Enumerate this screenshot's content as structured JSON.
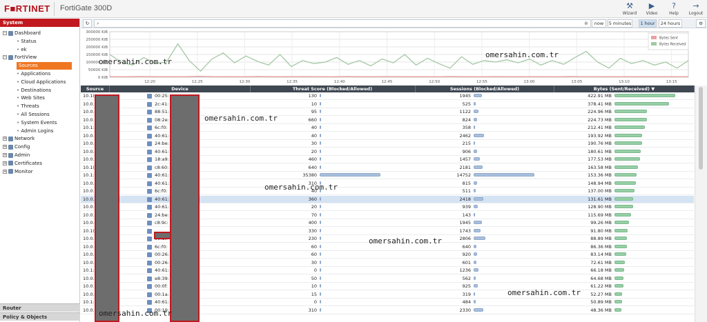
{
  "app": {
    "logo": "F■RTINET",
    "model": "FortiGate 300D"
  },
  "top_actions": [
    {
      "label": "Wizard",
      "icon": "wizard-icon",
      "glyph": "⚒"
    },
    {
      "label": "Video",
      "icon": "video-icon",
      "glyph": "▶"
    },
    {
      "label": "Help",
      "icon": "help-icon",
      "glyph": "?"
    },
    {
      "label": "Logout",
      "icon": "logout-icon",
      "glyph": "→"
    }
  ],
  "sidebar": {
    "section": "System",
    "tree": [
      {
        "label": "Dashboard",
        "level": 0,
        "expand": "−",
        "icon": true
      },
      {
        "label": "Status",
        "level": 1
      },
      {
        "label": "ek",
        "level": 1
      },
      {
        "label": "FortiView",
        "level": 0,
        "expand": "−",
        "icon": true
      },
      {
        "label": "Sources",
        "level": 1,
        "selected": true
      },
      {
        "label": "Applications",
        "level": 1
      },
      {
        "label": "Cloud Applications",
        "level": 1
      },
      {
        "label": "Destinations",
        "level": 1
      },
      {
        "label": "Web Sites",
        "level": 1
      },
      {
        "label": "Threats",
        "level": 1
      },
      {
        "label": "All Sessions",
        "level": 1
      },
      {
        "label": "System Events",
        "level": 1
      },
      {
        "label": "Admin Logins",
        "level": 1
      },
      {
        "label": "Network",
        "level": 0,
        "expand": "+",
        "icon": true
      },
      {
        "label": "Config",
        "level": 0,
        "expand": "+",
        "icon": true
      },
      {
        "label": "Admin",
        "level": 0,
        "expand": "+",
        "icon": true
      },
      {
        "label": "Certificates",
        "level": 0,
        "expand": "+",
        "icon": true
      },
      {
        "label": "Monitor",
        "level": 0,
        "expand": "+",
        "icon": true
      }
    ],
    "bottom": [
      "Router",
      "Policy & Objects"
    ]
  },
  "toolbar": {
    "refresh_glyph": "↻",
    "search_glyph": "⌕",
    "clear_glyph": "⊗",
    "ranges": [
      {
        "label": "now"
      },
      {
        "label": "5 minutes"
      },
      {
        "label": "1 hour",
        "active": true
      },
      {
        "label": "24 hours"
      }
    ],
    "settings_glyph": "⚙"
  },
  "chart_data": {
    "type": "line",
    "title": "",
    "xlabel": "",
    "ylabel": "",
    "ylim": [
      0,
      300000
    ],
    "y_ticks": [
      "300000 KiB",
      "250000 KiB",
      "200000 KiB",
      "150000 KiB",
      "100000 KiB",
      "50000 KiB",
      "0 KiB"
    ],
    "x_ticks": [
      "12:20",
      "12:25",
      "12:30",
      "12:35",
      "12:40",
      "12:45",
      "12:50",
      "12:55",
      "13:00",
      "13:05",
      "13:10",
      "13:15"
    ],
    "legend": [
      "Bytes Sent",
      "Bytes Received"
    ],
    "legend_placement": "top-right",
    "grid": true,
    "series": [
      {
        "name": "Bytes Sent",
        "color": "#e8a0a0",
        "values": [
          4000,
          3000,
          5000,
          3500,
          4200,
          3000,
          6000,
          4000,
          3800,
          3200,
          5000,
          4100,
          3600,
          4400,
          3900,
          3000,
          5200,
          3800,
          4000,
          4600,
          3500,
          4000,
          3300,
          4900,
          3700,
          3100,
          4500,
          3800,
          4200,
          3600,
          3000,
          4800,
          3900,
          4100,
          3500,
          4300,
          3800,
          4000,
          3600,
          4200
        ]
      },
      {
        "name": "Bytes Received",
        "color": "#a5c8a5",
        "values": [
          150000,
          100000,
          80000,
          130000,
          90000,
          100000,
          220000,
          110000,
          40000,
          120000,
          160000,
          95000,
          140000,
          105000,
          80000,
          150000,
          70000,
          110000,
          90000,
          100000,
          130000,
          85000,
          110000,
          75000,
          120000,
          95000,
          150000,
          80000,
          125000,
          90000,
          60000,
          135000,
          85000,
          110000,
          100000,
          115000,
          95000,
          120000,
          80000,
          110000,
          85000,
          130000,
          170000,
          100000,
          60000,
          125000,
          90000,
          110000,
          80000,
          100000,
          60000,
          110000
        ]
      }
    ]
  },
  "table": {
    "columns": [
      "Source",
      "Device",
      "Threat Score (Blocked/Allowed)",
      "Sessions (Blocked/Allowed)",
      "Bytes (Sent/Received) ▼"
    ],
    "max_threat": 35380,
    "max_sessions": 14752,
    "max_bytes": 422.91,
    "rows": [
      {
        "src": "10.1(",
        "dev": "00:25:",
        "threat": 130,
        "sessions": 1945,
        "bytes": "422.91 MB",
        "bv": 422.91
      },
      {
        "src": "10.0.",
        "dev": "2c:41:",
        "threat": 10,
        "sessions": 525,
        "bytes": "378.41 MB",
        "bv": 378.41
      },
      {
        "src": "10.0.",
        "dev": "88:51:",
        "threat": 95,
        "sessions": 1122,
        "bytes": "224.96 MB",
        "bv": 224.96
      },
      {
        "src": "10.0.",
        "dev": "08:2e:",
        "threat": 660,
        "sessions": 824,
        "bytes": "224.73 MB",
        "bv": 224.73
      },
      {
        "src": "10.1:",
        "dev": "6c:f0:",
        "threat": 40,
        "sessions": 358,
        "bytes": "212.41 MB",
        "bv": 212.41
      },
      {
        "src": "10.0.",
        "dev": "40:61:",
        "threat": 40,
        "sessions": 2462,
        "bytes": "193.92 MB",
        "bv": 193.92
      },
      {
        "src": "10.0.",
        "dev": "24:be:",
        "threat": 30,
        "sessions": 215,
        "bytes": "190.76 MB",
        "bv": 190.76
      },
      {
        "src": "10.0.",
        "dev": "40:61:",
        "threat": 20,
        "sessions": 906,
        "bytes": "180.61 MB",
        "bv": 180.61
      },
      {
        "src": "10.0.",
        "dev": "18:a9:",
        "threat": 460,
        "sessions": 1457,
        "bytes": "177.53 MB",
        "bv": 177.53
      },
      {
        "src": "10.1(",
        "dev": "c8:60:",
        "threat": 640,
        "sessions": 2181,
        "bytes": "163.58 MB",
        "bv": 163.58
      },
      {
        "src": "10.1:",
        "dev": "40:61:",
        "threat": 35380,
        "sessions": 14752,
        "bytes": "153.36 MB",
        "bv": 153.36
      },
      {
        "src": "10.0.",
        "dev": "40:61:",
        "threat": 310,
        "sessions": 815,
        "bytes": "148.94 MB",
        "bv": 148.94
      },
      {
        "src": "10.0.",
        "dev": "6c:f0:",
        "threat": 40,
        "sessions": 511,
        "bytes": "137.00 MB",
        "bv": 137.0
      },
      {
        "src": "10.0.",
        "dev": "40:61:",
        "threat": 360,
        "sessions": 2418,
        "bytes": "131.61 MB",
        "bv": 131.61,
        "selected": true
      },
      {
        "src": "10.0.",
        "dev": "40:61:",
        "threat": 20,
        "sessions": 939,
        "bytes": "128.90 MB",
        "bv": 128.9
      },
      {
        "src": "10.0.",
        "dev": "24:be:",
        "threat": 70,
        "sessions": 143,
        "bytes": "115.69 MB",
        "bv": 115.69
      },
      {
        "src": "10.0.",
        "dev": "c8:9c:",
        "threat": 400,
        "sessions": 1945,
        "bytes": "99.26 MB",
        "bv": 99.26
      },
      {
        "src": "10.1(",
        "dev": "",
        "threat": 330,
        "sessions": 1743,
        "bytes": "91.80 MB",
        "bv": 91.8
      },
      {
        "src": "10.0.",
        "dev": "00:1f:",
        "threat": 230,
        "sessions": 2806,
        "bytes": "88.89 MB",
        "bv": 88.89
      },
      {
        "src": "10.0.",
        "dev": "6c:f0:",
        "threat": 60,
        "sessions": 640,
        "bytes": "86.36 MB",
        "bv": 86.36
      },
      {
        "src": "10.0.",
        "dev": "00:26:",
        "threat": 60,
        "sessions": 920,
        "bytes": "83.14 MB",
        "bv": 83.14
      },
      {
        "src": "10.0.",
        "dev": "00:26:",
        "threat": 30,
        "sessions": 601,
        "bytes": "72.61 MB",
        "bv": 72.61
      },
      {
        "src": "10.1:",
        "dev": "40:61:",
        "threat": 0,
        "sessions": 1236,
        "bytes": "66.18 MB",
        "bv": 66.18
      },
      {
        "src": "10.0.",
        "dev": "e8:39:",
        "threat": 50,
        "sessions": 562,
        "bytes": "64.68 MB",
        "bv": 64.68
      },
      {
        "src": "10.0.",
        "dev": "00:0f:",
        "threat": 10,
        "sessions": 925,
        "bytes": "61.22 MB",
        "bv": 61.22
      },
      {
        "src": "10.0.",
        "dev": "00:1a:",
        "threat": 15,
        "sessions": 319,
        "bytes": "52.27 MB",
        "bv": 52.27
      },
      {
        "src": "10.1:",
        "dev": "40:61:",
        "threat": 0,
        "sessions": 484,
        "bytes": "50.89 MB",
        "bv": 50.89
      },
      {
        "src": "10.0.",
        "dev": "00:19:",
        "threat": 310,
        "sessions": 2330,
        "bytes": "48.36 MB",
        "bv": 48.36
      }
    ]
  },
  "watermarks": [
    "omersahin.com.tr",
    "omersahin.com.tr",
    "omersahin.com.tr",
    "omersahin.com.tr",
    "omersahin.com.tr",
    "omersahin.com.tr",
    "omersahin.com.tr"
  ]
}
